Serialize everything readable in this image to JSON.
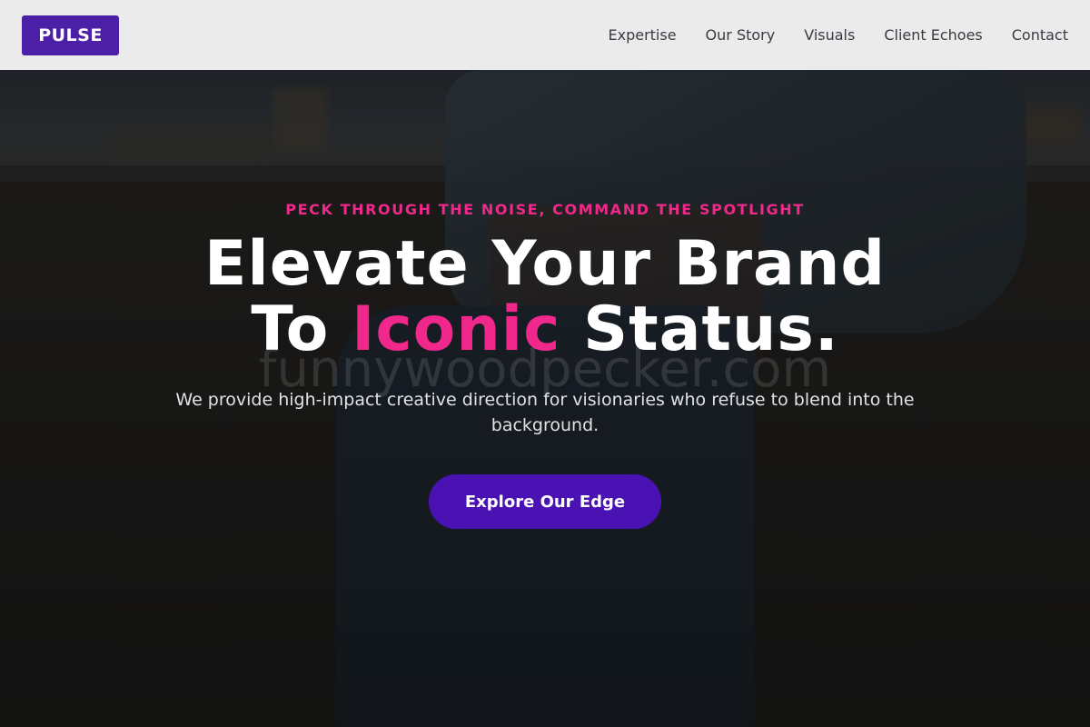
{
  "header": {
    "logo": "PULSE",
    "nav": [
      {
        "label": "Expertise"
      },
      {
        "label": "Our Story"
      },
      {
        "label": "Visuals"
      },
      {
        "label": "Client Echoes"
      },
      {
        "label": "Contact"
      }
    ]
  },
  "hero": {
    "tagline": "PECK THROUGH THE NOISE, COMMAND THE SPOTLIGHT",
    "headline_line1": "Elevate Your Brand",
    "headline_line2_prefix": "To ",
    "headline_line2_accent": "Iconic",
    "headline_line2_suffix": " Status.",
    "watermark": "funnywoodpecker.com",
    "subtext": "We provide high-impact creative direction for visionaries who refuse to blend into the background.",
    "cta_label": "Explore Our Edge"
  },
  "colors": {
    "brand_purple": "#4c1fa7",
    "accent_pink": "#f0288c",
    "cta_purple": "#4a12b3",
    "header_bg": "#ebebeb"
  }
}
